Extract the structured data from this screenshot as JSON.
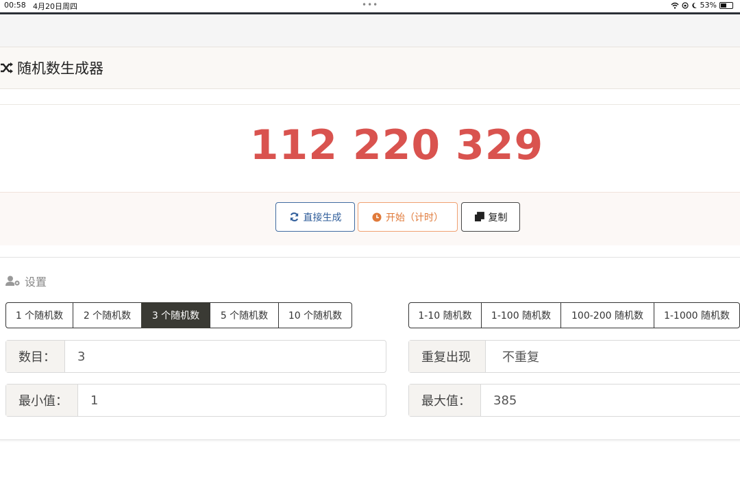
{
  "status_bar": {
    "time": "00:58",
    "date": "4月20日周四",
    "battery": "53%",
    "battery_level": 0.53
  },
  "app": {
    "title": "随机数生成器",
    "title_icon": "shuffle-icon"
  },
  "result": {
    "numbers": "112 220 329",
    "color": "#d9534f"
  },
  "actions": {
    "generate_label": "直接生成",
    "start_label": "开始（计时）",
    "copy_label": "复制"
  },
  "settings": {
    "heading": "设置",
    "count_presets": [
      "1 个随机数",
      "2 个随机数",
      "3 个随机数",
      "5 个随机数",
      "10 个随机数"
    ],
    "count_selected": "3 个随机数",
    "range_presets": [
      "1-10 随机数",
      "1-100 随机数",
      "100-200 随机数",
      "1-1000 随机数"
    ],
    "count_label": "数目：",
    "count_value": "3",
    "repeat_label": "重复出现",
    "repeat_value": "不重复",
    "min_label": "最小值：",
    "min_value": "1",
    "max_label": "最大值：",
    "max_value": "385"
  },
  "colors": {
    "primary": "#2f5d9a",
    "warning": "#e07a3a",
    "active_segment": "#3a3a34"
  }
}
